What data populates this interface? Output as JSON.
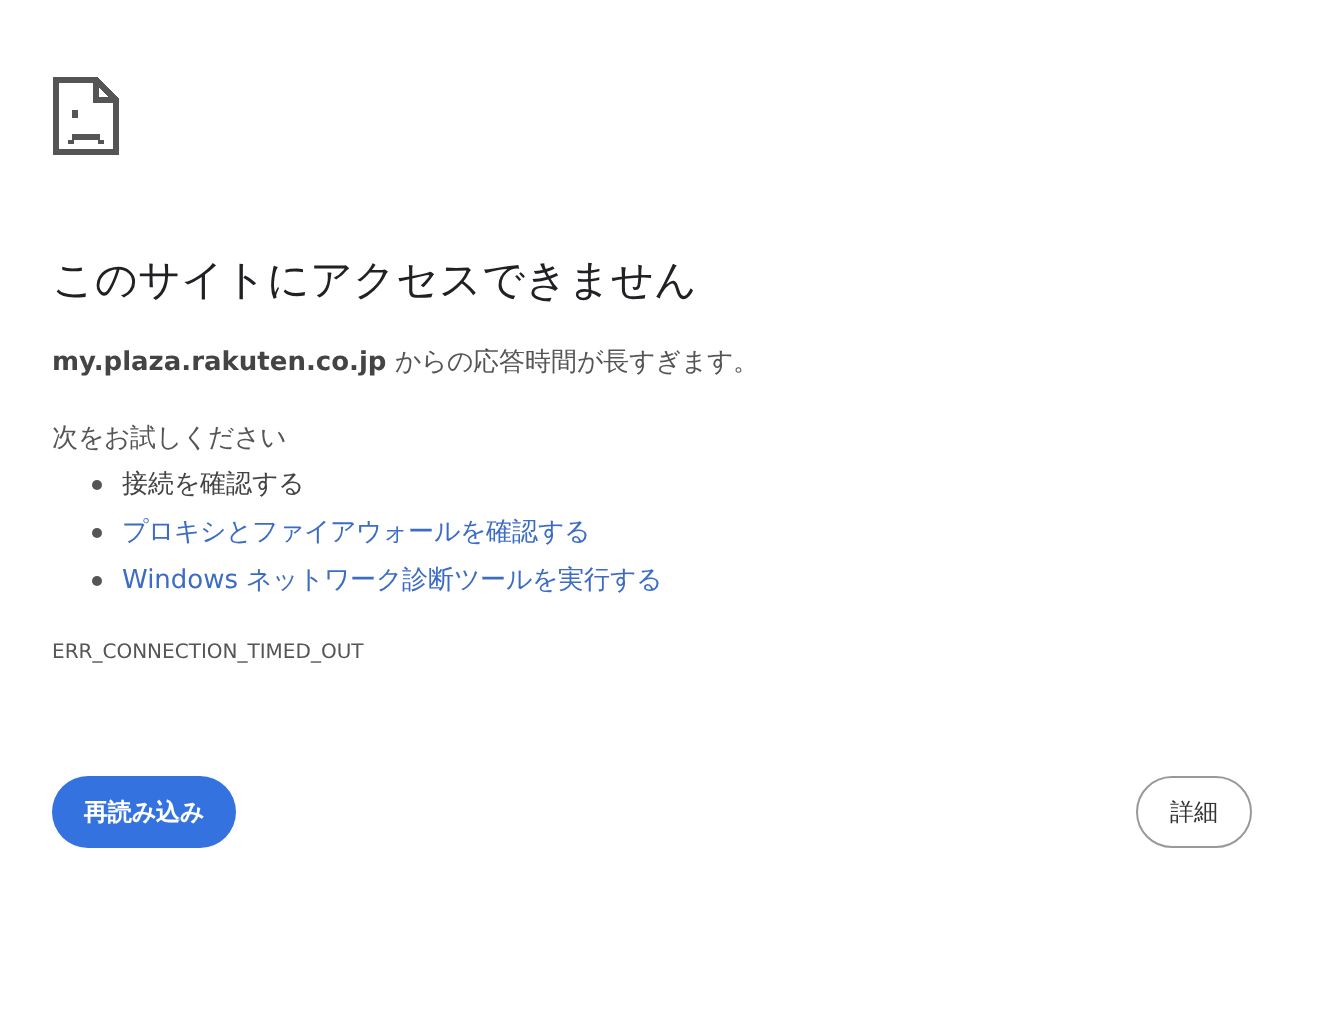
{
  "heading": "このサイトにアクセスできません",
  "message": "**my.plaza.rakuten.co.jp** からの応答時間が長すぎます。",
  "suggestions_title": "次をお試しください",
  "suggestions": [
    {
      "kind": "text",
      "label": "接続を確認する"
    },
    {
      "kind": "link",
      "label": "プロキシとファイアウォールを確認する"
    },
    {
      "kind": "link",
      "label": "Windows ネットワーク診断ツールを実行する"
    }
  ],
  "error_code": "ERR_CONNECTION_TIMED_OUT",
  "buttons": [
    {
      "kind": "primary",
      "label": "再読み込み"
    },
    {
      "kind": "secondary",
      "label": "詳細"
    }
  ]
}
